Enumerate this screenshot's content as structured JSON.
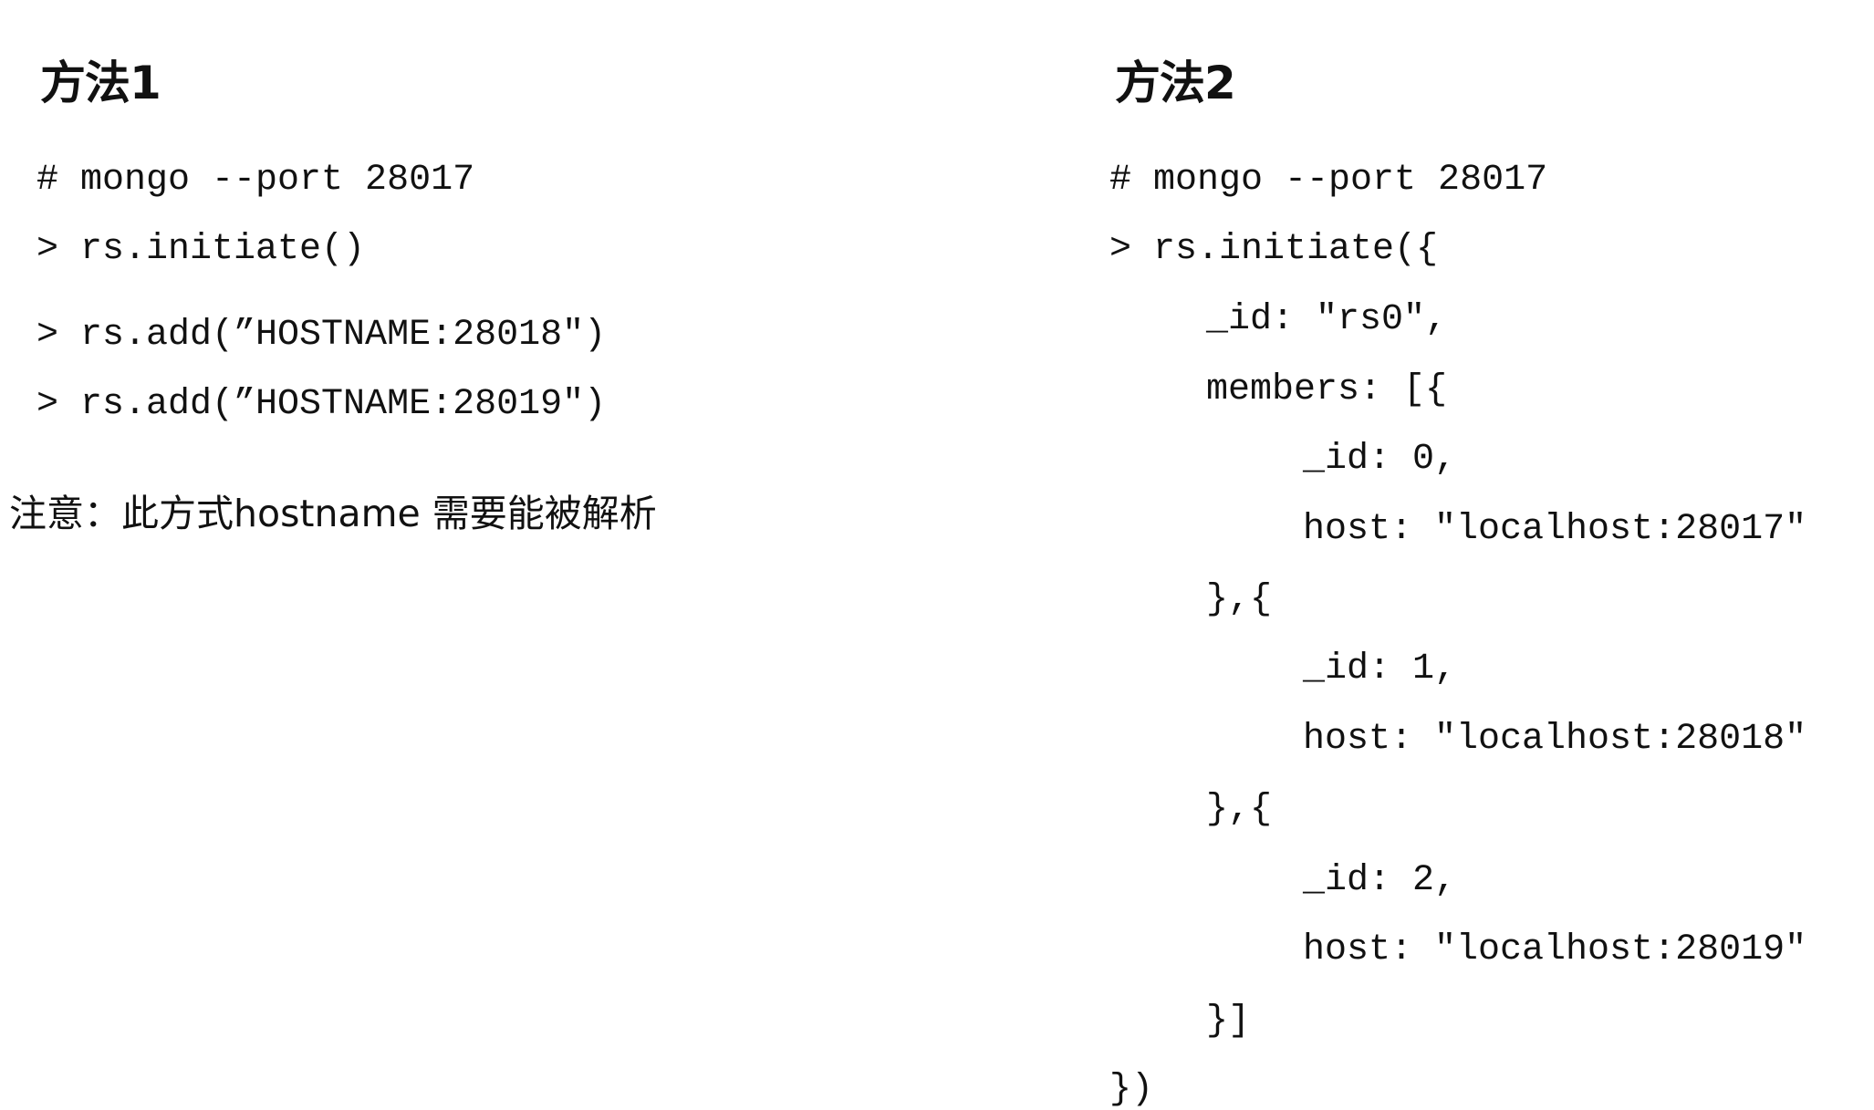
{
  "method1": {
    "title": "方法1",
    "lines": [
      "# mongo --port 28017",
      "> rs.initiate()",
      "> rs.add(”HOSTNAME:28018\")",
      "> rs.add(”HOSTNAME:28019\")"
    ],
    "note": "注意：此方式hostname 需要能被解析"
  },
  "method2": {
    "title": "方法2",
    "lines": [
      "# mongo --port 28017",
      "> rs.initiate({",
      "_id: \"rs0\",",
      "members: [{",
      "_id: 0,",
      "host: \"localhost:28017\"",
      "},{",
      "_id: 1,",
      "host: \"localhost:28018\"",
      "},{",
      "_id: 2,",
      "host: \"localhost:28019\"",
      "}]",
      "})"
    ]
  }
}
